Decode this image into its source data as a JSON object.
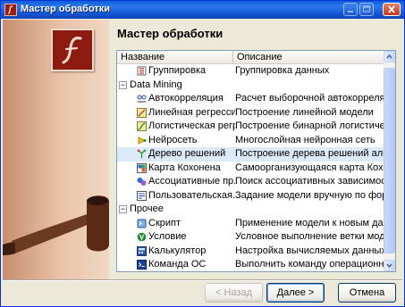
{
  "window": {
    "title": "Мастер обработки",
    "controls": [
      "minimize",
      "maximize",
      "close"
    ]
  },
  "main": {
    "heading": "Мастер обработки"
  },
  "list": {
    "columns": [
      "Название",
      "Описание"
    ],
    "rows": [
      {
        "kind": "item",
        "icon": "grouping-icon",
        "name": "Группировка",
        "desc": "Группировка данных"
      },
      {
        "kind": "group",
        "expander": "−",
        "name": "Data Mining"
      },
      {
        "kind": "item",
        "icon": "autocorrelation-icon",
        "name": "Автокорреляция",
        "desc": "Расчет выборочной автокорреляци..."
      },
      {
        "kind": "item",
        "icon": "linear-regression-icon",
        "name": "Линейная регрессия",
        "desc": "Построение линейной модели"
      },
      {
        "kind": "item",
        "icon": "logistic-regression-icon",
        "name": "Логистическая регр...",
        "desc": "Построение бинарной логистическо..."
      },
      {
        "kind": "item",
        "icon": "neural-network-icon",
        "name": "Нейросеть",
        "desc": "Многослойная нейронная сеть"
      },
      {
        "kind": "item",
        "icon": "decision-tree-icon",
        "name": "Дерево решений",
        "desc": "Построение дерева решений алгор...",
        "selected": true
      },
      {
        "kind": "item",
        "icon": "kohonen-map-icon",
        "name": "Карта Кохонена",
        "desc": "Самоорганизующаяся карта Кохон..."
      },
      {
        "kind": "item",
        "icon": "association-rules-icon",
        "name": "Ассоциативные пр...",
        "desc": "Поиск ассоциативных зависимостей"
      },
      {
        "kind": "item",
        "icon": "custom-model-icon",
        "name": "Пользовательская...",
        "desc": "Задание модели вручную по формул..."
      },
      {
        "kind": "group",
        "expander": "−",
        "name": "Прочее"
      },
      {
        "kind": "item",
        "icon": "script-icon",
        "name": "Скрипт",
        "desc": "Применение модели к новым данн..."
      },
      {
        "kind": "item",
        "icon": "condition-icon",
        "name": "Условие",
        "desc": "Условное выполнение ветки модели"
      },
      {
        "kind": "item",
        "icon": "calculator-icon",
        "name": "Калькулятор",
        "desc": "Настройка вычисляемых данных"
      },
      {
        "kind": "item",
        "icon": "os-command-icon",
        "name": "Команда ОС",
        "desc": "Выполнить команду операционной ..."
      }
    ]
  },
  "buttons": {
    "back": "< Назад",
    "next": "Далее >",
    "cancel": "Отмена"
  },
  "colors": {
    "title_bar": "#1458d4",
    "selection": "#dce9f7",
    "logo_tile": "#8c1a10",
    "side_panel": "#e9c3a9"
  }
}
